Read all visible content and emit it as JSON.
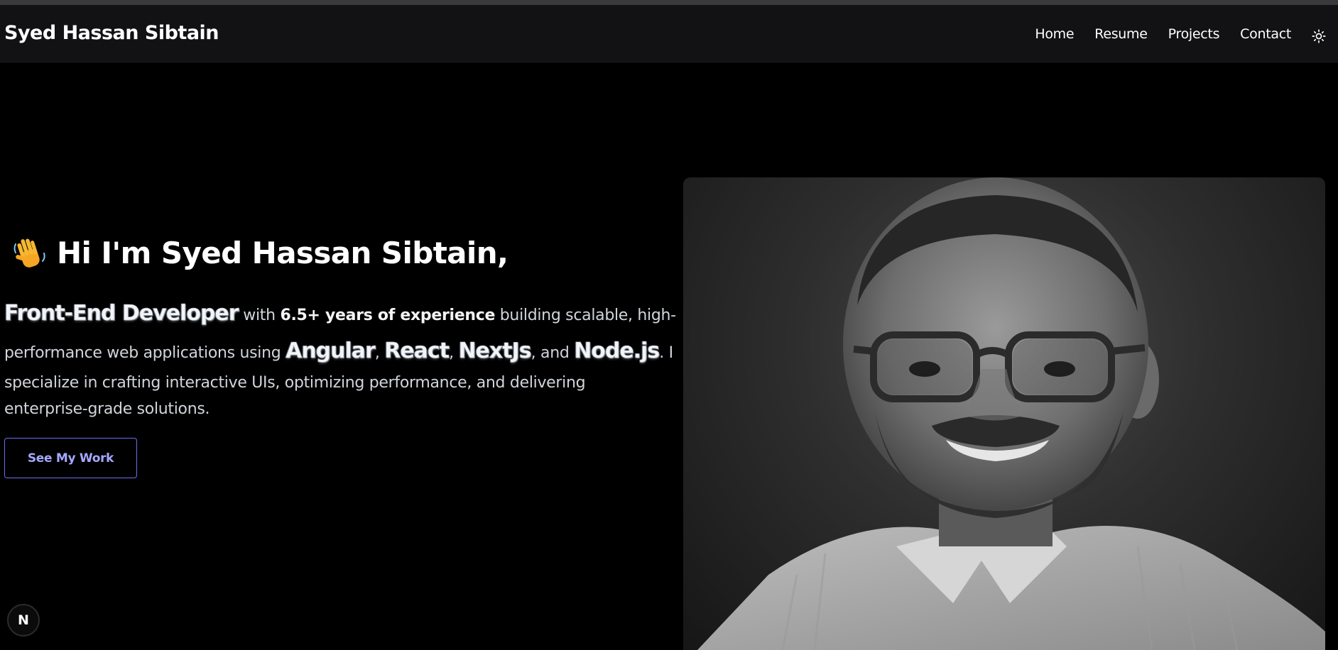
{
  "navbar": {
    "brand": "Syed Hassan Sibtain",
    "links": [
      {
        "label": "Home"
      },
      {
        "label": "Resume"
      },
      {
        "label": "Projects"
      },
      {
        "label": "Contact"
      }
    ],
    "theme_icon": "sun-icon"
  },
  "hero": {
    "wave_icon": "waving-hand-icon",
    "title": "Hi I'm Syed Hassan Sibtain,",
    "role": "Front-End Developer",
    "with": " with ",
    "experience": "6.5+ years of experience",
    "building": " building scalable, high-",
    "performance": "performance web applications using ",
    "tech1": "Angular",
    "comma1": ", ",
    "tech2": "React",
    "comma2": ", ",
    "tech3": "NextJs",
    "and": ", and ",
    "tech4": "Node.js",
    "period": ". I",
    "line3": "specialize in crafting interactive UIs, optimizing performance, and delivering",
    "line4": "enterprise-grade solutions.",
    "cta_label": "See My Work"
  },
  "portrait": {
    "icon": "profile-photo"
  },
  "badge": {
    "label": "N",
    "icon": "nextjs-icon"
  },
  "colors": {
    "background": "#000000",
    "navbar": "#121214",
    "accent": "#6d6df0",
    "cta_text": "#a5a8ff"
  }
}
